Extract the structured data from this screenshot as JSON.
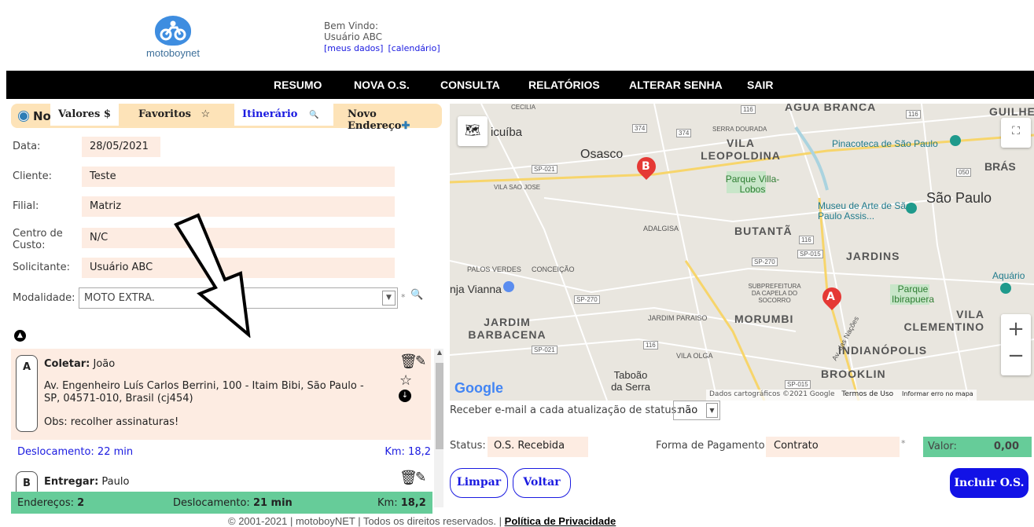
{
  "brand": {
    "name": "motoboynet"
  },
  "welcome": {
    "greeting": "Bem Vindo:",
    "user": "Usuário ABC",
    "link_meus_dados": "[meus dados]",
    "link_calendario": "[calendário]"
  },
  "nav": [
    "RESUMO",
    "NOVA O.S.",
    "CONSULTA",
    "RELATÓRIOS",
    "ALTERAR SENHA",
    "SAIR"
  ],
  "form": {
    "title": "Nova O.S.",
    "data_label": "Data:",
    "data_value": "28/05/2021",
    "cliente_label": "Cliente:",
    "cliente_value": "Teste",
    "filial_label": "Filial:",
    "filial_value": "Matriz",
    "centro_label": "Centro de Custo:",
    "centro_value": "N/C",
    "solicitante_label": "Solicitante:",
    "solicitante_value": "Usuário ABC",
    "modalidade_label": "Modalidade:",
    "modalidade_value": "MOTO EXTRA.",
    "modalidade_required": "*"
  },
  "tabs": {
    "valores": "Valores $",
    "favoritos": "Favoritos",
    "itinerario": "Itinerário",
    "novo_endereco": "Novo Endereço"
  },
  "stops": [
    {
      "letter": "A",
      "action": "Coletar:",
      "name": "João",
      "address": "Av. Engenheiro Luís Carlos Berrini, 100 - Itaim Bibi, São Paulo - SP, 04571-010, Brasil (cj454)",
      "obs": "Obs: recolher assinaturas!",
      "deslocamento": "Deslocamento: 22 min",
      "km": "Km: 18,2"
    },
    {
      "letter": "B",
      "action": "Entregar:",
      "name": "Paulo"
    }
  ],
  "summary": {
    "enderecos_label": "Endereços:",
    "enderecos_value": "2",
    "desloc_label": "Deslocamento:",
    "desloc_value": "21 min",
    "km_label": "Km:",
    "km_value": "18,2"
  },
  "map": {
    "labels": [
      "Osasco",
      "VILA LEOPOLDINA",
      "Parque Villa-Lobos",
      "Pinacoteca de São Paulo",
      "São Paulo",
      "BRÁS",
      "Museu de Arte de São Paulo Assis...",
      "BUTANTÃ",
      "JARDINS",
      "ADALGISA",
      "PALOS VERDES",
      "CONCEIÇÃO",
      "SUBPREFEITURA DA CAPELA DO SOCORRO",
      "Parque Ibirapuera",
      "Aquário",
      "VILA CLEMENTINO",
      "JARDIM BARBACENA",
      "MORUMBI",
      "JARDIM PARAISO",
      "INDIANÓPOLIS",
      "Taboão da Serra",
      "BROOKLIN",
      "VILA OLGA",
      "VILA SAO JOSE",
      "SERRA DOURADA",
      "CECILIA",
      "AGUA BRANCA",
      "GUILHE",
      "icuíba",
      "nja Vianna",
      "Av. das Nações"
    ],
    "markers": [
      "A",
      "B"
    ],
    "attribution": "Dados cartográficos ©2021 Google",
    "terms": "Termos de Uso",
    "report": "Informar erro no mapa",
    "google": "Google",
    "roads": [
      "374",
      "374",
      "116",
      "116",
      "SP-021",
      "050",
      "116",
      "SP-015",
      "SP-270",
      "SP-270",
      "SP-021",
      "116",
      "SP-015"
    ]
  },
  "status": {
    "email_label": "Receber e-mail a cada atualização de status:",
    "email_value": "não",
    "status_label": "Status:",
    "status_value": "O.S. Recebida",
    "pagamento_label": "Forma de Pagamento:",
    "pagamento_value": "Contrato",
    "pagamento_required": "*",
    "valor_label": "Valor:",
    "valor_value": "0,00"
  },
  "buttons": {
    "limpar": "Limpar",
    "voltar": "Voltar",
    "incluir": "Incluir O.S."
  },
  "footer": {
    "text": "© 2001-2021 | motoboyNET | Todos os direitos reservados. |",
    "privacy": "Política de Privacidade"
  }
}
